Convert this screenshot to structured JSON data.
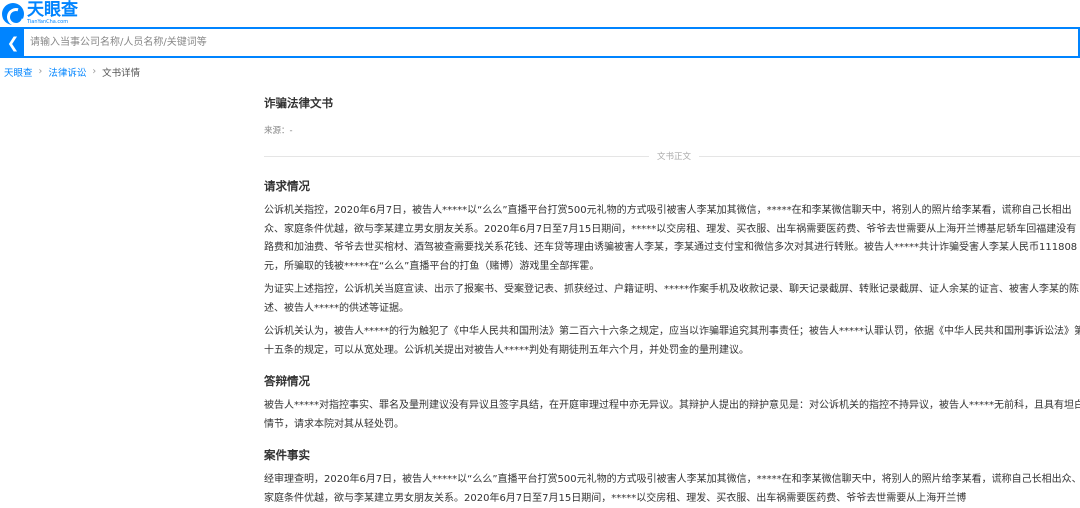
{
  "header": {
    "logo_text": "天眼查",
    "logo_sub": "TianYanCha.com"
  },
  "search": {
    "back_icon": "chevron-left-icon",
    "placeholder": "请输入当事公司名称/人员名称/关键词等"
  },
  "breadcrumb": {
    "items": [
      "天眼查",
      "法律诉讼",
      "文书详情"
    ],
    "separator": "›"
  },
  "document": {
    "title": "诈骗法律文书",
    "source": "来源：-",
    "divider_label": "文书正文",
    "sections": [
      {
        "heading": "请求情况",
        "paragraphs": [
          "公诉机关指控，2020年6月7日，被告人*****以“么么”直播平台打赏500元礼物的方式吸引被害人李某加其微信，*****在和李某微信聊天中，将别人的照片给李某看，谎称自己长相出众、家庭条件优越，欲与李某建立男女朋友关系。2020年6月7日至7月15日期间，*****以交房租、理发、买衣服、出车祸需要医药费、爷爷去世需要从上海开兰博基尼轿车回福建没有路费和加油费、爷爷去世买棺材、酒驾被查需要找关系花钱、还车贷等理由诱骗被害人李某，李某通过支付宝和微信多次对其进行转账。被告人*****共计诈骗受害人李某人民币111808元，所骗取的钱被*****在“么么”直播平台的打鱼（赌博）游戏里全部挥霍。",
          "为证实上述指控，公诉机关当庭宣读、出示了报案书、受案登记表、抓获经过、户籍证明、*****作案手机及收款记录、聊天记录截屏、转账记录截屏、证人余某的证言、被害人李某的陈述、被告人*****的供述等证据。",
          "公诉机关认为，被告人*****的行为触犯了《中华人民共和国刑法》第二百六十六条之规定，应当以诈骗罪追究其刑事责任；被告人*****认罪认罚，依据《中华人民共和国刑事诉讼法》第十五条的规定，可以从宽处理。公诉机关提出对被告人*****判处有期徒刑五年六个月，并处罚金的量刑建议。"
        ]
      },
      {
        "heading": "答辩情况",
        "paragraphs": [
          "被告人*****对指控事实、罪名及量刑建议没有异议且签字具结，在开庭审理过程中亦无异议。其辩护人提出的辩护意见是：对公诉机关的指控不持异议，被告人*****无前科，且具有坦白情节，请求本院对其从轻处罚。"
        ]
      },
      {
        "heading": "案件事实",
        "paragraphs": [
          "经审理查明，2020年6月7日，被告人*****以“么么”直播平台打赏500元礼物的方式吸引被害人李某加其微信，*****在和李某微信聊天中，将别人的照片给李某看，谎称自己长相出众、家庭条件优越，欲与李某建立男女朋友关系。2020年6月7日至7月15日期间，*****以交房租、理发、买衣服、出车祸需要医药费、爷爷去世需要从上海开兰博"
        ]
      }
    ]
  },
  "colors": {
    "brand": "#0084ff",
    "text": "#333333",
    "muted": "#888888"
  }
}
